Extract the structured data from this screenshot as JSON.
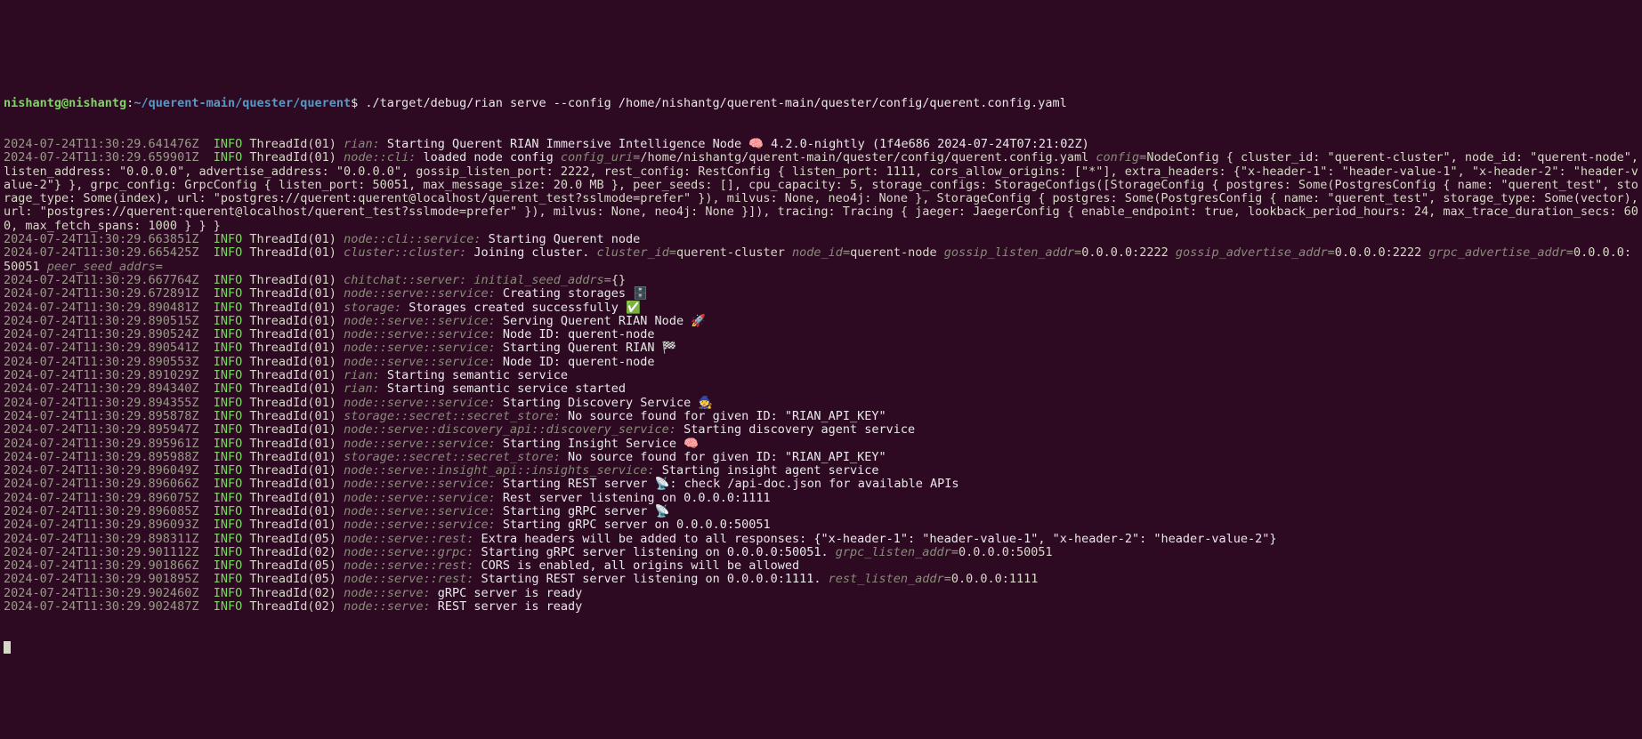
{
  "prompt": {
    "user": "nishantg@nishantg",
    "colon1": ":",
    "path": "~/querent-main/quester/querent",
    "dollar": "$ ",
    "cmd": "./target/debug/rian serve --config /home/nishantg/querent-main/quester/config/querent.config.yaml"
  },
  "lines": [
    {
      "ts": "2024-07-24T11:30:29.641476Z",
      "lvl": "INFO",
      "th": "ThreadId(01)",
      "mod": "rian:",
      "msg": " Starting Querent RIAN Immersive Intelligence Node 🧠 4.2.0-nightly (1f4e686 2024-07-24T07:21:02Z)"
    },
    {
      "ts": "2024-07-24T11:30:29.659901Z",
      "lvl": "INFO",
      "th": "ThreadId(01)",
      "mod": "node::cli:",
      "msg": " loaded node config ",
      "kvs": [
        [
          "config_uri",
          "/home/nishantg/querent-main/quester/config/querent.config.yaml"
        ],
        [
          "config",
          "NodeConfig { cluster_id: \"querent-cluster\", node_id: \"querent-node\", listen_address: \"0.0.0.0\", advertise_address: \"0.0.0.0\", gossip_listen_port: 2222, rest_config: RestConfig { listen_port: 1111, cors_allow_origins: [\"*\"], extra_headers: {\"x-header-1\": \"header-value-1\", \"x-header-2\": \"header-value-2\"} }, grpc_config: GrpcConfig { listen_port: 50051, max_message_size: 20.0 MB }, peer_seeds: [], cpu_capacity: 5, storage_configs: StorageConfigs([StorageConfig { postgres: Some(PostgresConfig { name: \"querent_test\", storage_type: Some(index), url: \"postgres://querent:querent@localhost/querent_test?sslmode=prefer\" }), milvus: None, neo4j: None }, StorageConfig { postgres: Some(PostgresConfig { name: \"querent_test\", storage_type: Some(vector), url: \"postgres://querent:querent@localhost/querent_test?sslmode=prefer\" }), milvus: None, neo4j: None }]), tracing: Tracing { jaeger: JaegerConfig { enable_endpoint: true, lookback_period_hours: 24, max_trace_duration_secs: 600, max_fetch_spans: 1000 } } }"
        ]
      ]
    },
    {
      "ts": "2024-07-24T11:30:29.663851Z",
      "lvl": "INFO",
      "th": "ThreadId(01)",
      "mod": "node::cli::service:",
      "msg": " Starting Querent node"
    },
    {
      "ts": "2024-07-24T11:30:29.665425Z",
      "lvl": "INFO",
      "th": "ThreadId(01)",
      "mod": "cluster::cluster:",
      "msg": " Joining cluster. ",
      "kvs": [
        [
          "cluster_id",
          "querent-cluster"
        ],
        [
          "node_id",
          "querent-node"
        ],
        [
          "gossip_listen_addr",
          "0.0.0.0:2222"
        ],
        [
          "gossip_advertise_addr",
          "0.0.0.0:2222"
        ],
        [
          "grpc_advertise_addr",
          "0.0.0.0:50051"
        ],
        [
          "peer_seed_addrs",
          ""
        ]
      ]
    },
    {
      "ts": "2024-07-24T11:30:29.667764Z",
      "lvl": "INFO",
      "th": "ThreadId(01)",
      "mod": "chitchat::server:",
      "msg": " ",
      "kvs": [
        [
          "initial_seed_addrs",
          "{}"
        ]
      ]
    },
    {
      "ts": "2024-07-24T11:30:29.672891Z",
      "lvl": "INFO",
      "th": "ThreadId(01)",
      "mod": "node::serve::service:",
      "msg": " Creating storages 🗄️"
    },
    {
      "ts": "2024-07-24T11:30:29.890481Z",
      "lvl": "INFO",
      "th": "ThreadId(01)",
      "mod": "storage:",
      "msg": " Storages created successfully ✅"
    },
    {
      "ts": "2024-07-24T11:30:29.890515Z",
      "lvl": "INFO",
      "th": "ThreadId(01)",
      "mod": "node::serve::service:",
      "msg": " Serving Querent RIAN Node 🚀"
    },
    {
      "ts": "2024-07-24T11:30:29.890524Z",
      "lvl": "INFO",
      "th": "ThreadId(01)",
      "mod": "node::serve::service:",
      "msg": " Node ID: querent-node"
    },
    {
      "ts": "2024-07-24T11:30:29.890541Z",
      "lvl": "INFO",
      "th": "ThreadId(01)",
      "mod": "node::serve::service:",
      "msg": " Starting Querent RIAN 🏁"
    },
    {
      "ts": "2024-07-24T11:30:29.890553Z",
      "lvl": "INFO",
      "th": "ThreadId(01)",
      "mod": "node::serve::service:",
      "msg": " Node ID: querent-node"
    },
    {
      "ts": "2024-07-24T11:30:29.891029Z",
      "lvl": "INFO",
      "th": "ThreadId(01)",
      "mod": "rian:",
      "msg": " Starting semantic service"
    },
    {
      "ts": "2024-07-24T11:30:29.894340Z",
      "lvl": "INFO",
      "th": "ThreadId(01)",
      "mod": "rian:",
      "msg": " Starting semantic service started"
    },
    {
      "ts": "2024-07-24T11:30:29.894355Z",
      "lvl": "INFO",
      "th": "ThreadId(01)",
      "mod": "node::serve::service:",
      "msg": " Starting Discovery Service 🧙"
    },
    {
      "ts": "2024-07-24T11:30:29.895878Z",
      "lvl": "INFO",
      "th": "ThreadId(01)",
      "mod": "storage::secret::secret_store:",
      "msg": " No source found for given ID: \"RIAN_API_KEY\""
    },
    {
      "ts": "2024-07-24T11:30:29.895947Z",
      "lvl": "INFO",
      "th": "ThreadId(01)",
      "mod": "node::serve::discovery_api::discovery_service:",
      "msg": " Starting discovery agent service"
    },
    {
      "ts": "2024-07-24T11:30:29.895961Z",
      "lvl": "INFO",
      "th": "ThreadId(01)",
      "mod": "node::serve::service:",
      "msg": " Starting Insight Service 🧠"
    },
    {
      "ts": "2024-07-24T11:30:29.895988Z",
      "lvl": "INFO",
      "th": "ThreadId(01)",
      "mod": "storage::secret::secret_store:",
      "msg": " No source found for given ID: \"RIAN_API_KEY\""
    },
    {
      "ts": "2024-07-24T11:30:29.896049Z",
      "lvl": "INFO",
      "th": "ThreadId(01)",
      "mod": "node::serve::insight_api::insights_service:",
      "msg": " Starting insight agent service"
    },
    {
      "ts": "2024-07-24T11:30:29.896066Z",
      "lvl": "INFO",
      "th": "ThreadId(01)",
      "mod": "node::serve::service:",
      "msg": " Starting REST server 📡: check /api-doc.json for available APIs"
    },
    {
      "ts": "2024-07-24T11:30:29.896075Z",
      "lvl": "INFO",
      "th": "ThreadId(01)",
      "mod": "node::serve::service:",
      "msg": " Rest server listening on 0.0.0.0:1111"
    },
    {
      "ts": "2024-07-24T11:30:29.896085Z",
      "lvl": "INFO",
      "th": "ThreadId(01)",
      "mod": "node::serve::service:",
      "msg": " Starting gRPC server 📡"
    },
    {
      "ts": "2024-07-24T11:30:29.896093Z",
      "lvl": "INFO",
      "th": "ThreadId(01)",
      "mod": "node::serve::service:",
      "msg": " Starting gRPC server on 0.0.0.0:50051"
    },
    {
      "ts": "2024-07-24T11:30:29.898311Z",
      "lvl": "INFO",
      "th": "ThreadId(05)",
      "mod": "node::serve::rest:",
      "msg": " Extra headers will be added to all responses: {\"x-header-1\": \"header-value-1\", \"x-header-2\": \"header-value-2\"}"
    },
    {
      "ts": "2024-07-24T11:30:29.901112Z",
      "lvl": "INFO",
      "th": "ThreadId(02)",
      "mod": "node::serve::grpc:",
      "msg": " Starting gRPC server listening on 0.0.0.0:50051. ",
      "kvs": [
        [
          "grpc_listen_addr",
          "0.0.0.0:50051"
        ]
      ]
    },
    {
      "ts": "2024-07-24T11:30:29.901866Z",
      "lvl": "INFO",
      "th": "ThreadId(05)",
      "mod": "node::serve::rest:",
      "msg": " CORS is enabled, all origins will be allowed"
    },
    {
      "ts": "2024-07-24T11:30:29.901895Z",
      "lvl": "INFO",
      "th": "ThreadId(05)",
      "mod": "node::serve::rest:",
      "msg": " Starting REST server listening on 0.0.0.0:1111. ",
      "kvs": [
        [
          "rest_listen_addr",
          "0.0.0.0:1111"
        ]
      ]
    },
    {
      "ts": "2024-07-24T11:30:29.902460Z",
      "lvl": "INFO",
      "th": "ThreadId(02)",
      "mod": "node::serve:",
      "msg": " gRPC server is ready"
    },
    {
      "ts": "2024-07-24T11:30:29.902487Z",
      "lvl": "INFO",
      "th": "ThreadId(02)",
      "mod": "node::serve:",
      "msg": " REST server is ready"
    }
  ]
}
